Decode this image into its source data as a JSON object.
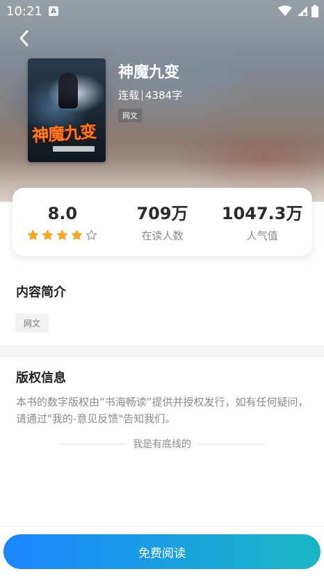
{
  "status_bar": {
    "time": "10:21",
    "notification_icon_letter": "A",
    "icons": [
      "wifi-icon",
      "signal-icon",
      "battery-icon"
    ]
  },
  "header": {
    "back_icon": "chevron-left-icon"
  },
  "book": {
    "cover_title": "神魔九变",
    "title": "神魔九变",
    "status": "连载",
    "word_count": "4384字",
    "tag": "网文"
  },
  "stats": {
    "rating": {
      "value": "8.0",
      "stars_filled": 4,
      "stars_total": 5
    },
    "readers": {
      "value": "709万",
      "label": "在读人数"
    },
    "popularity": {
      "value": "1047.3万",
      "label": "人气值"
    }
  },
  "intro": {
    "title": "内容简介",
    "tag": "网文"
  },
  "copyright": {
    "title": "版权信息",
    "text": "本书的数字版权由“书海畅读”提供并授权发行，如有任何疑问，请通过\"我的-意见反馈\"告知我们。"
  },
  "footer": {
    "end_text": "我是有底线的"
  },
  "actions": {
    "read_label": "免费阅读"
  },
  "colors": {
    "accent_start": "#1a86ff",
    "accent_end": "#1bb7c3",
    "star": "#f5a623"
  }
}
